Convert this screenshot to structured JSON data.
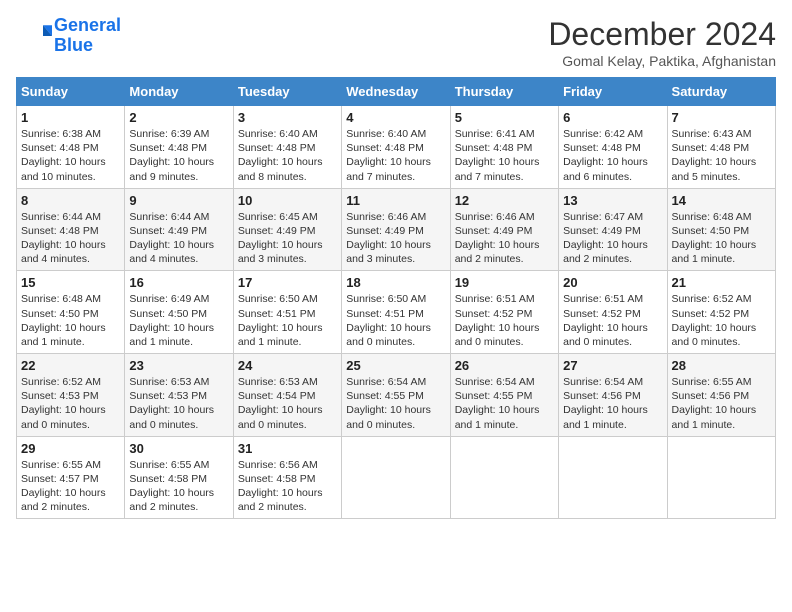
{
  "logo": {
    "line1": "General",
    "line2": "Blue"
  },
  "title": "December 2024",
  "location": "Gomal Kelay, Paktika, Afghanistan",
  "headers": [
    "Sunday",
    "Monday",
    "Tuesday",
    "Wednesday",
    "Thursday",
    "Friday",
    "Saturday"
  ],
  "weeks": [
    [
      {
        "day": "1",
        "info": "Sunrise: 6:38 AM\nSunset: 4:48 PM\nDaylight: 10 hours\nand 10 minutes."
      },
      {
        "day": "2",
        "info": "Sunrise: 6:39 AM\nSunset: 4:48 PM\nDaylight: 10 hours\nand 9 minutes."
      },
      {
        "day": "3",
        "info": "Sunrise: 6:40 AM\nSunset: 4:48 PM\nDaylight: 10 hours\nand 8 minutes."
      },
      {
        "day": "4",
        "info": "Sunrise: 6:40 AM\nSunset: 4:48 PM\nDaylight: 10 hours\nand 7 minutes."
      },
      {
        "day": "5",
        "info": "Sunrise: 6:41 AM\nSunset: 4:48 PM\nDaylight: 10 hours\nand 7 minutes."
      },
      {
        "day": "6",
        "info": "Sunrise: 6:42 AM\nSunset: 4:48 PM\nDaylight: 10 hours\nand 6 minutes."
      },
      {
        "day": "7",
        "info": "Sunrise: 6:43 AM\nSunset: 4:48 PM\nDaylight: 10 hours\nand 5 minutes."
      }
    ],
    [
      {
        "day": "8",
        "info": "Sunrise: 6:44 AM\nSunset: 4:48 PM\nDaylight: 10 hours\nand 4 minutes."
      },
      {
        "day": "9",
        "info": "Sunrise: 6:44 AM\nSunset: 4:49 PM\nDaylight: 10 hours\nand 4 minutes."
      },
      {
        "day": "10",
        "info": "Sunrise: 6:45 AM\nSunset: 4:49 PM\nDaylight: 10 hours\nand 3 minutes."
      },
      {
        "day": "11",
        "info": "Sunrise: 6:46 AM\nSunset: 4:49 PM\nDaylight: 10 hours\nand 3 minutes."
      },
      {
        "day": "12",
        "info": "Sunrise: 6:46 AM\nSunset: 4:49 PM\nDaylight: 10 hours\nand 2 minutes."
      },
      {
        "day": "13",
        "info": "Sunrise: 6:47 AM\nSunset: 4:49 PM\nDaylight: 10 hours\nand 2 minutes."
      },
      {
        "day": "14",
        "info": "Sunrise: 6:48 AM\nSunset: 4:50 PM\nDaylight: 10 hours\nand 1 minute."
      }
    ],
    [
      {
        "day": "15",
        "info": "Sunrise: 6:48 AM\nSunset: 4:50 PM\nDaylight: 10 hours\nand 1 minute."
      },
      {
        "day": "16",
        "info": "Sunrise: 6:49 AM\nSunset: 4:50 PM\nDaylight: 10 hours\nand 1 minute."
      },
      {
        "day": "17",
        "info": "Sunrise: 6:50 AM\nSunset: 4:51 PM\nDaylight: 10 hours\nand 1 minute."
      },
      {
        "day": "18",
        "info": "Sunrise: 6:50 AM\nSunset: 4:51 PM\nDaylight: 10 hours\nand 0 minutes."
      },
      {
        "day": "19",
        "info": "Sunrise: 6:51 AM\nSunset: 4:52 PM\nDaylight: 10 hours\nand 0 minutes."
      },
      {
        "day": "20",
        "info": "Sunrise: 6:51 AM\nSunset: 4:52 PM\nDaylight: 10 hours\nand 0 minutes."
      },
      {
        "day": "21",
        "info": "Sunrise: 6:52 AM\nSunset: 4:52 PM\nDaylight: 10 hours\nand 0 minutes."
      }
    ],
    [
      {
        "day": "22",
        "info": "Sunrise: 6:52 AM\nSunset: 4:53 PM\nDaylight: 10 hours\nand 0 minutes."
      },
      {
        "day": "23",
        "info": "Sunrise: 6:53 AM\nSunset: 4:53 PM\nDaylight: 10 hours\nand 0 minutes."
      },
      {
        "day": "24",
        "info": "Sunrise: 6:53 AM\nSunset: 4:54 PM\nDaylight: 10 hours\nand 0 minutes."
      },
      {
        "day": "25",
        "info": "Sunrise: 6:54 AM\nSunset: 4:55 PM\nDaylight: 10 hours\nand 0 minutes."
      },
      {
        "day": "26",
        "info": "Sunrise: 6:54 AM\nSunset: 4:55 PM\nDaylight: 10 hours\nand 1 minute."
      },
      {
        "day": "27",
        "info": "Sunrise: 6:54 AM\nSunset: 4:56 PM\nDaylight: 10 hours\nand 1 minute."
      },
      {
        "day": "28",
        "info": "Sunrise: 6:55 AM\nSunset: 4:56 PM\nDaylight: 10 hours\nand 1 minute."
      }
    ],
    [
      {
        "day": "29",
        "info": "Sunrise: 6:55 AM\nSunset: 4:57 PM\nDaylight: 10 hours\nand 2 minutes."
      },
      {
        "day": "30",
        "info": "Sunrise: 6:55 AM\nSunset: 4:58 PM\nDaylight: 10 hours\nand 2 minutes."
      },
      {
        "day": "31",
        "info": "Sunrise: 6:56 AM\nSunset: 4:58 PM\nDaylight: 10 hours\nand 2 minutes."
      },
      {
        "day": "",
        "info": ""
      },
      {
        "day": "",
        "info": ""
      },
      {
        "day": "",
        "info": ""
      },
      {
        "day": "",
        "info": ""
      }
    ]
  ]
}
